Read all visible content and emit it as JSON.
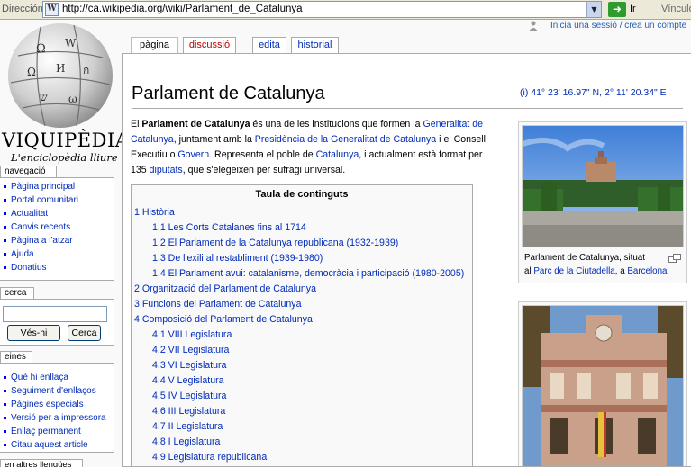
{
  "browser": {
    "address_label": "Dirección",
    "url": "http://ca.wikipedia.org/wiki/Parlament_de_Catalunya",
    "go_label": "Ir",
    "links_label": "Vínculo"
  },
  "personal": {
    "login_text": "Inicia una sessió / crea un compte"
  },
  "logo": {
    "wordmark": "VIQUIPÈDIA",
    "tagline": "L'enciclopèdia lliure"
  },
  "tabs": [
    {
      "label": "pàgina"
    },
    {
      "label": "discussió"
    },
    {
      "label": "edita"
    },
    {
      "label": "historial"
    }
  ],
  "sidebar": {
    "nav_title": "navegació",
    "nav_items": [
      "Pàgina principal",
      "Portal comunitari",
      "Actualitat",
      "Canvis recents",
      "Pàgina a l'atzar",
      "Ajuda",
      "Donatius"
    ],
    "search_title": "cerca",
    "search_go": "Vés-hi",
    "search_button": "Cerca",
    "tools_title": "eines",
    "tools_items": [
      "Què hi enllaça",
      "Seguiment d'enllaços",
      "Pàgines especials",
      "Versió per a impressora",
      "Enllaç permanent",
      "Citau aquest article"
    ],
    "languages_title": "en altres llengües"
  },
  "article": {
    "title": "Parlament de Catalunya",
    "coords": "(i) 41° 23' 16.97\" N, 2° 11' 20.34\" E",
    "intro": {
      "t1": "El ",
      "b1": "Parlament de Catalunya",
      "t2": " és una de les institucions que formen la ",
      "l1": "Generalitat de Catalunya",
      "t3": ", juntament amb la ",
      "l2": "Presidència de la Generalitat de Catalunya",
      "t4": " i el Consell Executiu o ",
      "l3": "Govern",
      "t5": ". Representa el poble de ",
      "l4": "Catalunya",
      "t6": ", i actualment està format per 135 ",
      "l5": "diputats",
      "t7": ", que s'elegeixen per sufragi universal."
    }
  },
  "toc": {
    "title": "Taula de continguts",
    "items": [
      "1 Història",
      "1.1 Les Corts Catalanes fins al 1714",
      "1.2 El Parlament de la Catalunya republicana (1932-1939)",
      "1.3 De l'exili al restabliment (1939-1980)",
      "1.4 El Parlament avui: catalanisme, democràcia i participació (1980-2005)",
      "2 Organització del Parlament de Catalunya",
      "3 Funcions del Parlament de Catalunya",
      "4 Composició del Parlament de Catalunya",
      "4.1 VIII Legislatura",
      "4.2 VII Legislatura",
      "4.3 VI Legislatura",
      "4.4 V Legislatura",
      "4.5 IV Legislatura",
      "4.6 III Legislatura",
      "4.7 II Legislatura",
      "4.8 I Legislatura",
      "4.9 Legislatura republicana"
    ]
  },
  "thumb1": {
    "caption1": "Parlament de Catalunya, situat",
    "caption2_pre": "al ",
    "caption2_link1": "Parc de la Ciutadella",
    "caption2_mid": ", a ",
    "caption2_link2": "Barcelona"
  }
}
